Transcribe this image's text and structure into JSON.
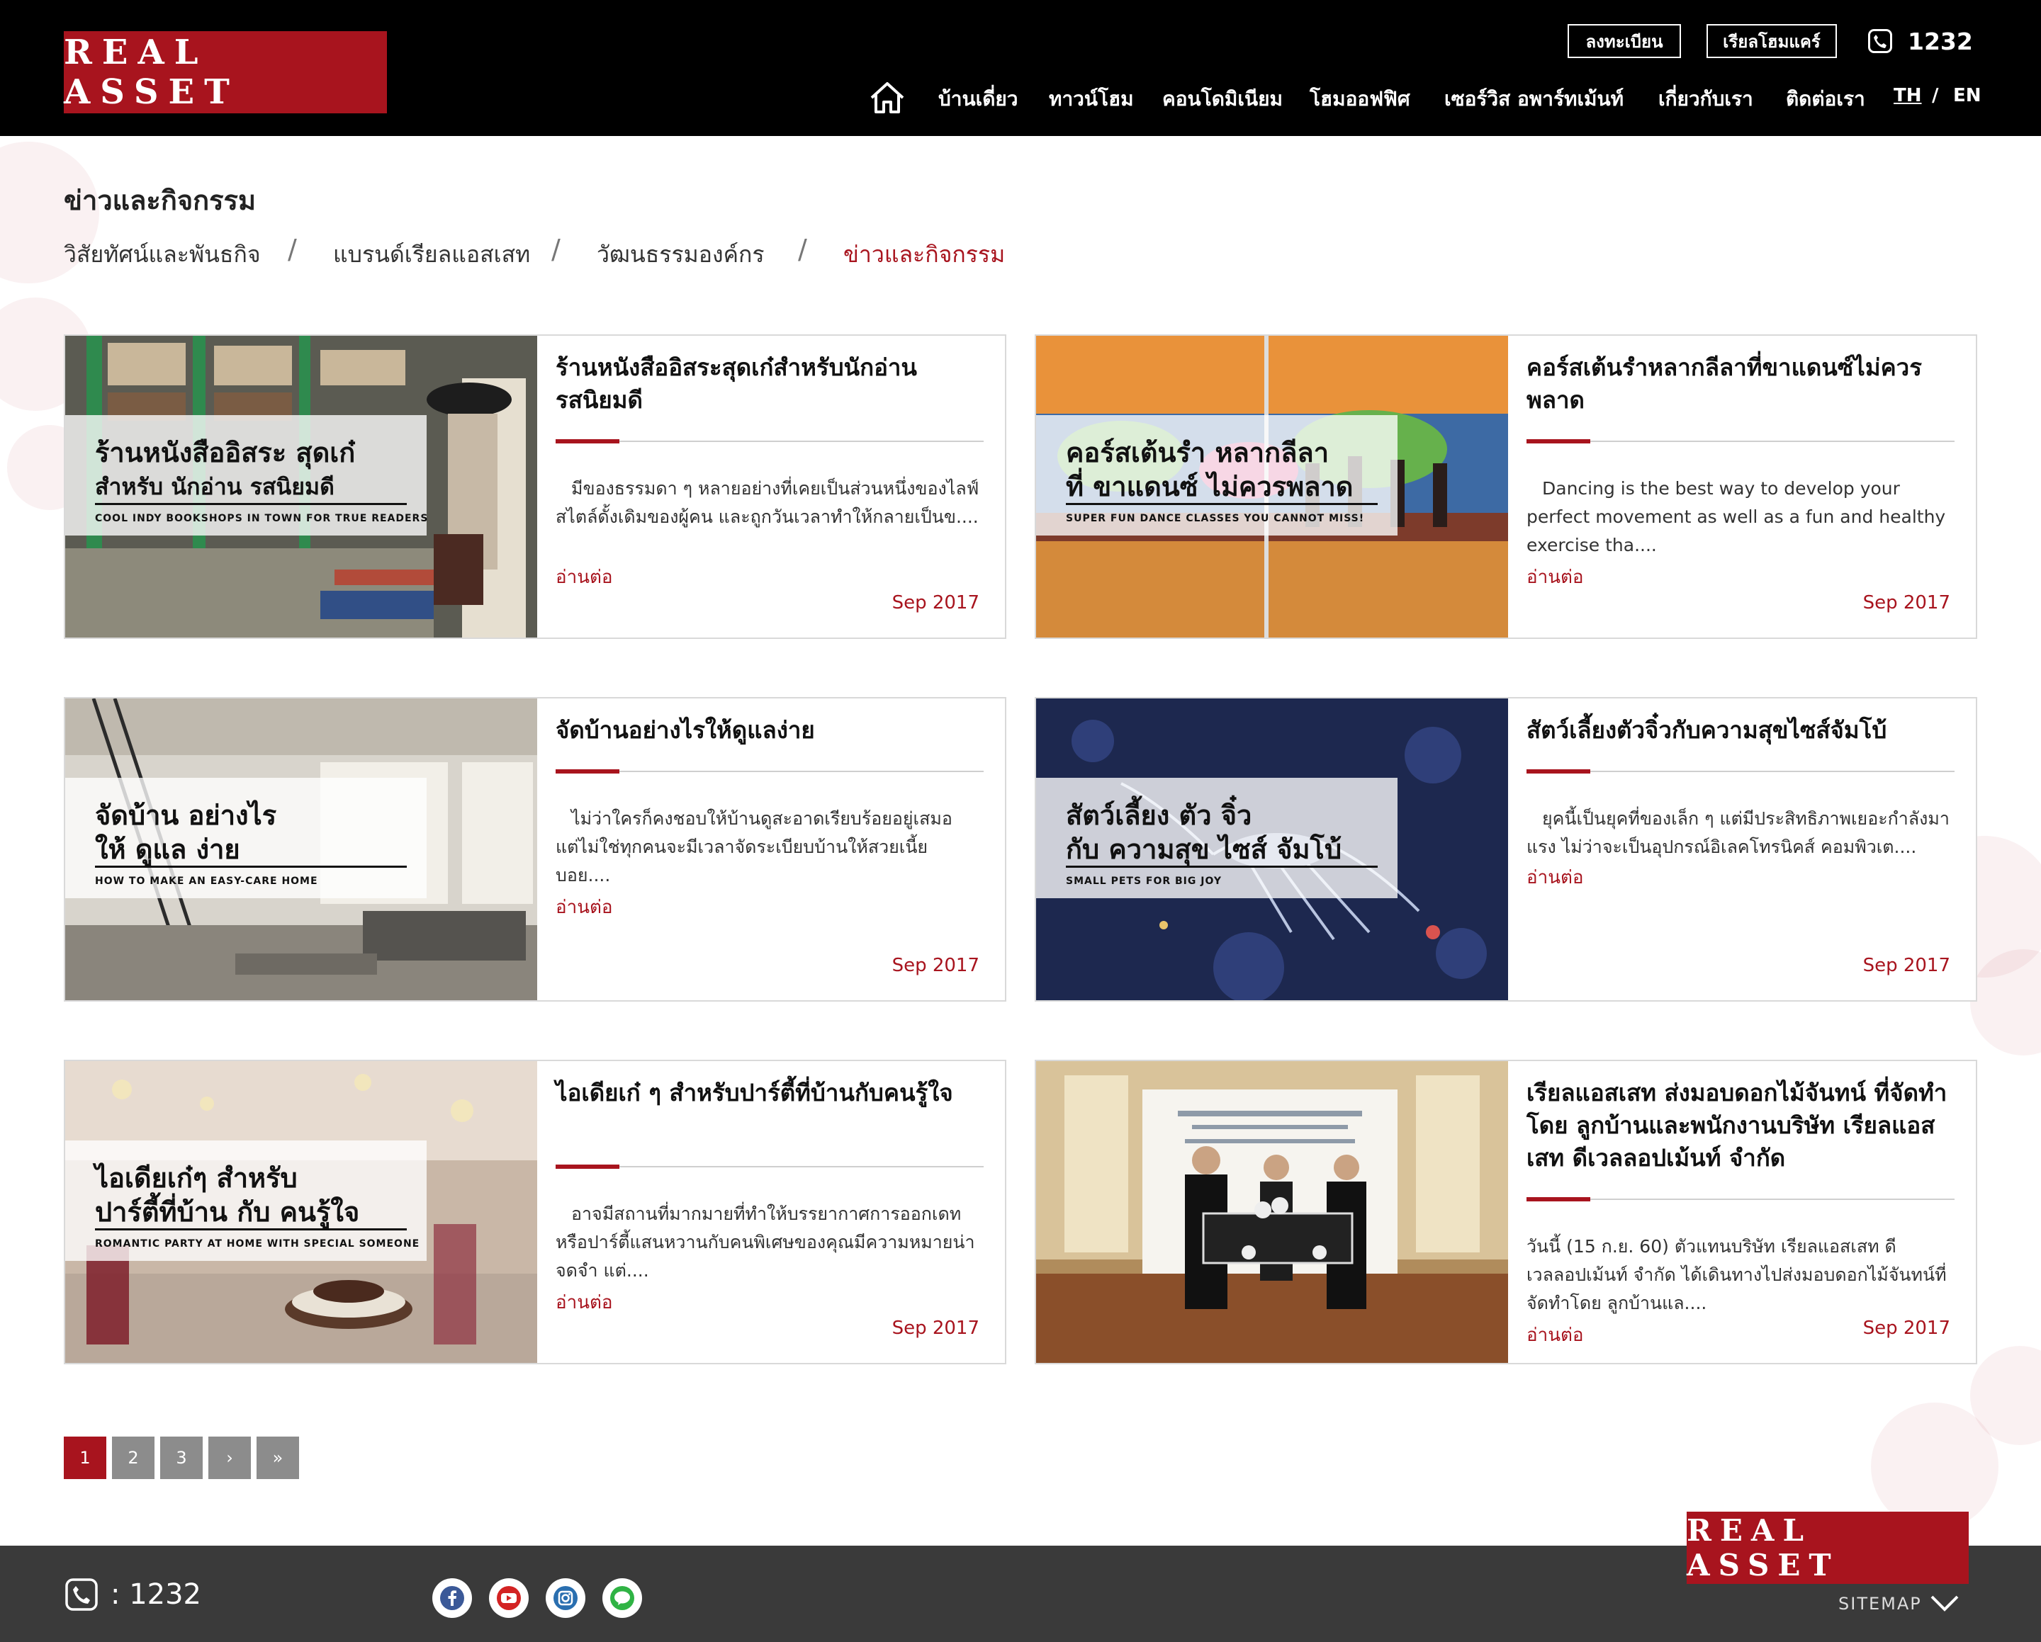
{
  "brand": {
    "logo": "REAL ASSET",
    "accent": "#a8141e"
  },
  "header": {
    "register_label": "ลงทะเบียน",
    "homecare_label": "เรียลโฮมแคร์",
    "phone": "1232",
    "nav": [
      "บ้านเดี่ยว",
      "ทาวน์โฮม",
      "คอนโดมิเนียม",
      "โฮมออฟฟิศ",
      "เซอร์วิส อพาร์ทเม้นท์",
      "เกี่ยวกับเรา",
      "ติดต่อเรา"
    ],
    "lang_th": "TH",
    "lang_sep": "/",
    "lang_en": "EN"
  },
  "page": {
    "title": "ข่าวและกิจกรรม",
    "breadcrumb": [
      "วิสัยทัศน์และพันธกิจ",
      "แบรนด์เรียลแอสเสท",
      "วัฒนธรรมองค์กร",
      "ข่าวและกิจกรรม"
    ],
    "breadcrumb_sep": "/"
  },
  "articles": [
    {
      "title": "ร้านหนังสืออิสระสุดเก๋สำหรับนักอ่านรสนิยมดี",
      "excerpt": "มีของธรรมดา ๆ หลายอย่างที่เคยเป็นส่วนหนึ่งของไลฟ์สไตล์ดั้งเดิมของผู้คน และถูกวันเวลาทำให้กลายเป็นข....",
      "more": "อ่านต่อ",
      "date": "Sep 2017",
      "overlay": {
        "line1": "ร้านหนังสืออิสระ สุดเก๋",
        "line2": "สำหรับ นักอ่าน รสนิยมดี",
        "sub": "COOL INDY BOOKSHOPS IN TOWN FOR TRUE READERS"
      }
    },
    {
      "title": "คอร์สเต้นรำหลากลีลาที่ขาแดนซ์ไม่ควรพลาด",
      "excerpt": "Dancing is the best way to develop your perfect movement as well as a fun and healthy exercise tha....",
      "more": "อ่านต่อ",
      "date": "Sep 2017",
      "overlay": {
        "line1": "คอร์สเต้นรำ หลากลีลา",
        "line2": "ที่ ขาแดนซ์ ไม่ควรพลาด",
        "sub": "SUPER FUN DANCE CLASSES YOU CANNOT MISS!"
      }
    },
    {
      "title": "จัดบ้านอย่างไรให้ดูแลง่าย",
      "excerpt": "ไม่ว่าใครก็คงชอบให้บ้านดูสะอาดเรียบร้อยอยู่เสมอ แต่ไม่ใช่ทุกคนจะมีเวลาจัดระเบียบบ้านให้สวยเนี้ยบอย....",
      "more": "อ่านต่อ",
      "date": "Sep 2017",
      "overlay": {
        "line1": "จัดบ้าน อย่างไร",
        "line2": "ให้ ดูแล ง่าย",
        "sub": "HOW TO MAKE AN EASY-CARE HOME"
      }
    },
    {
      "title": "สัตว์เลี้ยงตัวจิ๋วกับความสุขไซส์จัมโบ้",
      "excerpt": "ยุคนี้เป็นยุคที่ของเล็ก ๆ แต่มีประสิทธิภาพเยอะกำลังมาแรง ไม่ว่าจะเป็นอุปกรณ์อิเลคโทรนิคส์ คอมพิวเต....",
      "more": "อ่านต่อ",
      "date": "Sep 2017",
      "overlay": {
        "line1": "สัตว์เลี้ยง ตัว จิ๋ว",
        "line2": "กับ ความสุข ไซส์ จัมโบ้",
        "sub": "SMALL PETS FOR BIG JOY"
      }
    },
    {
      "title": "ไอเดียเก๋ ๆ สำหรับปาร์ตี้ที่บ้านกับคนรู้ใจ",
      "excerpt": "อาจมีสถานที่มากมายที่ทำให้บรรยากาศการออกเดทหรือปาร์ตี้แสนหวานกับคนพิเศษของคุณมีความหมายน่าจดจำ แต่....",
      "more": "อ่านต่อ",
      "date": "Sep 2017",
      "overlay": {
        "line1": "ไอเดียเก๋ๆ สำหรับ",
        "line2": "ปาร์ตี้ที่บ้าน กับ คนรู้ใจ",
        "sub": "ROMANTIC PARTY AT HOME WITH SPECIAL SOMEONE"
      }
    },
    {
      "title": "เรียลแอสเสท ส่งมอบดอกไม้จันทน์ ที่จัดทำโดย ลูกบ้านและพนักงานบริษัท เรียลแอสเสท ดีเวลลอปเม้นท์ จำกัด",
      "excerpt": "วันนี้ (15 ก.ย. 60) ตัวแทนบริษัท เรียลแอสเสท ดีเวลลอปเม้นท์ จำกัด ได้เดินทางไปส่งมอบดอกไม้จันทน์ที่จัดทำโดย ลูกบ้านแล....",
      "more": "อ่านต่อ",
      "date": "Sep 2017",
      "overlay": null
    }
  ],
  "pagination": [
    "1",
    "2",
    "3",
    "›",
    "»"
  ],
  "footer": {
    "phone": ": 1232",
    "social": [
      "facebook-icon",
      "youtube-icon",
      "instagram-icon",
      "line-icon"
    ],
    "logo": "REAL ASSET",
    "sitemap": "SITEMAP"
  }
}
